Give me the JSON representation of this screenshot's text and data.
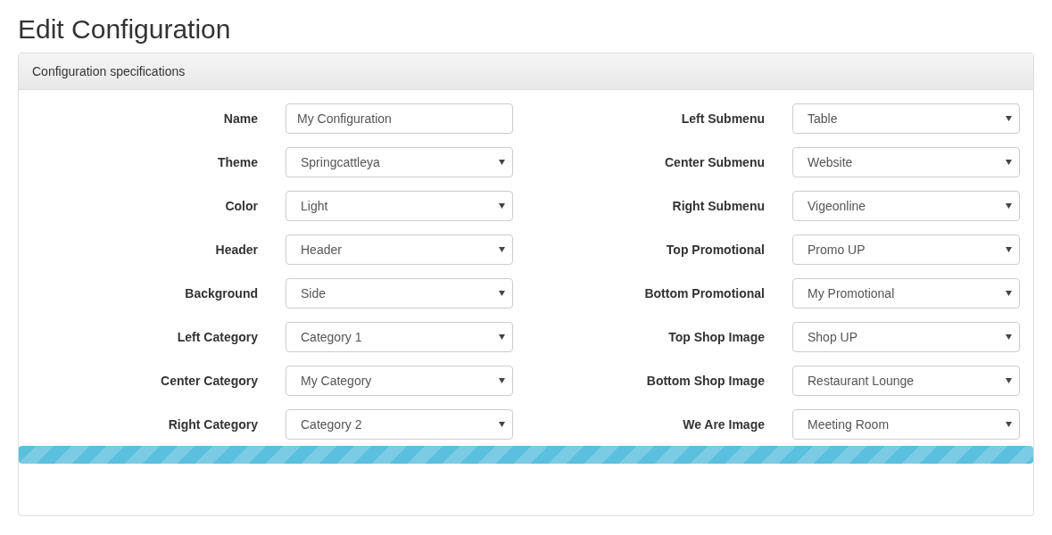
{
  "page_title": "Edit Configuration",
  "panel": {
    "heading": "Configuration specifications",
    "columns": [
      [
        {
          "label": "Name",
          "kind": "text",
          "value": "My Configuration"
        },
        {
          "label": "Theme",
          "kind": "select",
          "value": "Springcattleya"
        },
        {
          "label": "Color",
          "kind": "select",
          "value": "Light"
        },
        {
          "label": "Header",
          "kind": "select",
          "value": "Header"
        },
        {
          "label": "Background",
          "kind": "select",
          "value": "Side"
        },
        {
          "label": "Left Category",
          "kind": "select",
          "value": "Category 1"
        },
        {
          "label": "Center Category",
          "kind": "select",
          "value": "My Category"
        },
        {
          "label": "Right Category",
          "kind": "select",
          "value": "Category 2"
        }
      ],
      [
        {
          "label": "Left Submenu",
          "kind": "select",
          "value": "Table"
        },
        {
          "label": "Center Submenu",
          "kind": "select",
          "value": "Website"
        },
        {
          "label": "Right Submenu",
          "kind": "select",
          "value": "Vigeonline"
        },
        {
          "label": "Top Promotional",
          "kind": "select",
          "value": "Promo UP"
        },
        {
          "label": "Bottom Promotional",
          "kind": "select",
          "value": "My Promotional"
        },
        {
          "label": "Top Shop Image",
          "kind": "select",
          "value": "Shop UP"
        },
        {
          "label": "Bottom Shop Image",
          "kind": "select",
          "value": "Restaurant Lounge"
        },
        {
          "label": "We Are Image",
          "kind": "select",
          "value": "Meeting Room"
        }
      ]
    ],
    "progress": {
      "level": 1
    }
  }
}
